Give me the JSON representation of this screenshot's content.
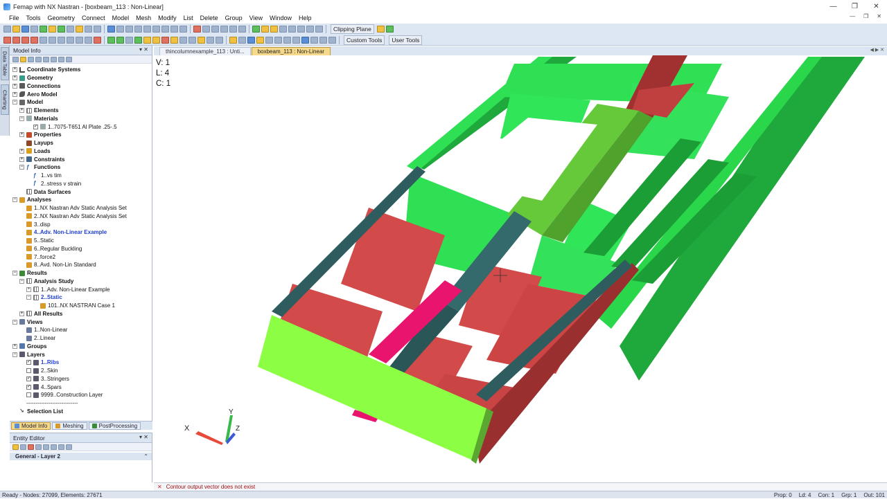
{
  "window": {
    "title": "Femap with NX Nastran - [boxbeam_113 : Non-Linear]",
    "minimize_icon": "minimize-icon",
    "maximize_icon": "restore-icon",
    "close_icon": "close-icon"
  },
  "menu": [
    "File",
    "Tools",
    "Geometry",
    "Connect",
    "Model",
    "Mesh",
    "Modify",
    "List",
    "Delete",
    "Group",
    "View",
    "Window",
    "Help"
  ],
  "toolbar": {
    "clipping_plane": "Clipping Plane",
    "custom_tools": "Custom Tools",
    "user_tools": "User Tools"
  },
  "side_tabs": [
    "Data Table",
    "Charting"
  ],
  "model_info": {
    "title": "Model Info",
    "tree": [
      {
        "label": "Coordinate Systems",
        "level": 0,
        "bold": true,
        "exp": "+",
        "icon": "axis"
      },
      {
        "label": "Geometry",
        "level": 0,
        "bold": true,
        "exp": "+",
        "icon": "geo"
      },
      {
        "label": "Connections",
        "level": 0,
        "bold": true,
        "exp": "+",
        "icon": "con"
      },
      {
        "label": "Aero Model",
        "level": 0,
        "bold": true,
        "exp": "+",
        "icon": "aero"
      },
      {
        "label": "Model",
        "level": 0,
        "bold": true,
        "exp": "−",
        "icon": "mod"
      },
      {
        "label": "Elements",
        "level": 1,
        "bold": true,
        "exp": "+",
        "icon": "grid"
      },
      {
        "label": "Materials",
        "level": 1,
        "bold": true,
        "exp": "−",
        "icon": "mat"
      },
      {
        "label": "1..7075-T651 Al Plate .25-.5",
        "level": 2,
        "bold": false,
        "cb": "✓",
        "icon": "mat"
      },
      {
        "label": "Properties",
        "level": 1,
        "bold": true,
        "exp": "+",
        "icon": "prop"
      },
      {
        "label": "Layups",
        "level": 1,
        "bold": true,
        "icon": "lay"
      },
      {
        "label": "Loads",
        "level": 1,
        "bold": true,
        "exp": "+",
        "icon": "load"
      },
      {
        "label": "Constraints",
        "level": 1,
        "bold": true,
        "exp": "+",
        "icon": "cons"
      },
      {
        "label": "Functions",
        "level": 1,
        "bold": true,
        "exp": "−",
        "icon": "fn"
      },
      {
        "label": "1..vs tim",
        "level": 2,
        "bold": false,
        "icon": "fn"
      },
      {
        "label": "2..stress v strain",
        "level": 2,
        "bold": false,
        "icon": "fn"
      },
      {
        "label": "Data Surfaces",
        "level": 1,
        "bold": true,
        "icon": "grid"
      },
      {
        "label": "Analyses",
        "level": 0,
        "bold": true,
        "exp": "−",
        "icon": "ana"
      },
      {
        "label": "1..NX Nastran Adv Static Analysis Set",
        "level": 1,
        "bold": false,
        "icon": "ana"
      },
      {
        "label": "2..NX Nastran Adv Static Analysis Set",
        "level": 1,
        "bold": false,
        "icon": "ana"
      },
      {
        "label": "3..disp",
        "level": 1,
        "bold": false,
        "icon": "ana"
      },
      {
        "label": "4..Adv. Non-Linear Example",
        "level": 1,
        "bold": false,
        "selected": true,
        "icon": "ana"
      },
      {
        "label": "5..Static",
        "level": 1,
        "bold": false,
        "icon": "ana"
      },
      {
        "label": "6..Regular Buckling",
        "level": 1,
        "bold": false,
        "icon": "ana"
      },
      {
        "label": "7..force2",
        "level": 1,
        "bold": false,
        "icon": "ana"
      },
      {
        "label": "8..Avd. Non-Lin Standard",
        "level": 1,
        "bold": false,
        "icon": "ana"
      },
      {
        "label": "Results",
        "level": 0,
        "bold": true,
        "exp": "−",
        "icon": "res"
      },
      {
        "label": "Analysis Study",
        "level": 1,
        "bold": true,
        "exp": "−",
        "icon": "grid"
      },
      {
        "label": "1..Adv. Non-Linear Example",
        "level": 2,
        "bold": false,
        "exp": "+",
        "icon": "grid"
      },
      {
        "label": "2..Static",
        "level": 2,
        "bold": false,
        "exp": "−",
        "selected": true,
        "icon": "grid"
      },
      {
        "label": "101..NX NASTRAN Case 1",
        "level": 3,
        "bold": false,
        "icon": "ana"
      },
      {
        "label": "All Results",
        "level": 1,
        "bold": true,
        "exp": "+",
        "icon": "grid"
      },
      {
        "label": "Views",
        "level": 0,
        "bold": true,
        "exp": "−",
        "icon": "view"
      },
      {
        "label": "1..Non-Linear",
        "level": 1,
        "bold": false,
        "icon": "view"
      },
      {
        "label": "2..Linear",
        "level": 1,
        "bold": false,
        "icon": "view"
      },
      {
        "label": "Groups",
        "level": 0,
        "bold": true,
        "exp": "+",
        "icon": "grp"
      },
      {
        "label": "Layers",
        "level": 0,
        "bold": true,
        "exp": "−",
        "icon": "layr"
      },
      {
        "label": "1..Ribs",
        "level": 1,
        "bold": false,
        "cb": "✓",
        "selected": true,
        "icon": "layr"
      },
      {
        "label": "2..Skin",
        "level": 1,
        "bold": false,
        "cb": "",
        "icon": "layr"
      },
      {
        "label": "3..Stringers",
        "level": 1,
        "bold": false,
        "cb": "✓",
        "icon": "layr"
      },
      {
        "label": "4..Spars",
        "level": 1,
        "bold": false,
        "cb": "✓",
        "icon": "layr"
      },
      {
        "label": "9999..Construction Layer",
        "level": 1,
        "bold": false,
        "cb": "",
        "icon": "layr"
      },
      {
        "label": "----------------------------",
        "level": 1,
        "bold": false,
        "icon": "none"
      },
      {
        "label": "Selection List",
        "level": 0,
        "bold": true,
        "icon": "sel"
      }
    ]
  },
  "bottom_tabs": [
    "Model Info",
    "Meshing",
    "PostProcessing"
  ],
  "entity_editor": {
    "title": "Entity Editor",
    "section": "General - Layer 2"
  },
  "view_tabs": [
    "thincolumnexample_113 : Unti...",
    "boxbeam_113 : Non-Linear"
  ],
  "viewport": {
    "v_line": "V: 1",
    "l_line": "L: 4",
    "c_line": "C: 1",
    "triad": {
      "x": "X",
      "y": "Y",
      "z": "Z"
    },
    "colors": {
      "spar_green": "#22dd55",
      "rib_red": "#d24a4a",
      "stringer_teal": "#2f5d5f",
      "endcap_lime": "#8cff44",
      "highlight_magenta": "#e8146e"
    }
  },
  "message": "Contour output vector does not exist",
  "status": {
    "left": "Ready - Nodes: 27099,  Elements: 27671",
    "prop": "Prop: 0",
    "ld": "Ld: 4",
    "con": "Con: 1",
    "grp": "Grp: 1",
    "out": "Out: 101"
  }
}
